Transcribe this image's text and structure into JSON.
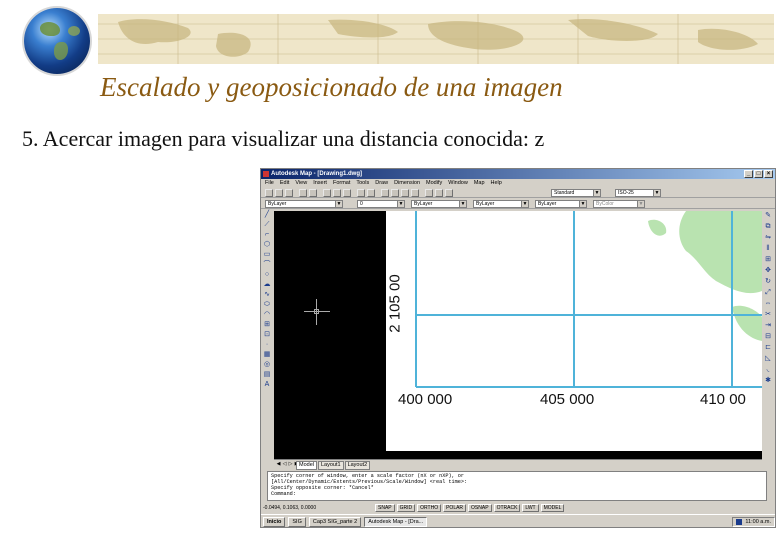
{
  "slide": {
    "title": "Escalado y  geoposicionado de una imagen",
    "subtitle": "5. Acercar imagen para visualizar una distancia conocida: z"
  },
  "app": {
    "window_title": "Autodesk Map - [Drawing1.dwg]",
    "menu": [
      "File",
      "Edit",
      "View",
      "Insert",
      "Format",
      "Tools",
      "Draw",
      "Dimension",
      "Modify",
      "Window",
      "Map",
      "Help"
    ],
    "toolbar": {
      "text_style": "Standard",
      "dim_style": "ISO-25",
      "layer": "0",
      "layer_control": "ByLayer",
      "color": "ByLayer",
      "linetype": "ByLayer",
      "lineweight": "ByLayer",
      "plot_style": "ByColor"
    },
    "canvas": {
      "grid_x_labels": [
        "400 000",
        "405 000",
        "410 00"
      ],
      "grid_y_label": "2 105 00",
      "raster_color": "#ffffff",
      "grid_line_color": "#4fb3d9",
      "terrain_color": "#b9e3b0"
    },
    "layout_tabs": [
      "Model",
      "Layout1",
      "Layout2"
    ],
    "active_tab": "Model",
    "command_lines": [
      "Specify corner of window, enter a scale factor (nX or nXP), or",
      "[All/Center/Dynamic/Extents/Previous/Scale/Window] <real time>:",
      "Specify opposite corner:  *Cancel*",
      "Command:"
    ],
    "status": {
      "coordinates": "-0.0494, 0.1063, 0.0000",
      "toggles": [
        "SNAP",
        "GRID",
        "ORTHO",
        "POLAR",
        "OSNAP",
        "OTRACK",
        "LWT",
        "MODEL"
      ]
    },
    "taskbar": {
      "start": "Inicio",
      "tasks": [
        "SIG",
        "Cap3 SIG_parte 2",
        "Autodesk Map - [Dra..."
      ],
      "active_task": "Autodesk Map - [Dra...",
      "clock": "11:00 a.m."
    }
  }
}
